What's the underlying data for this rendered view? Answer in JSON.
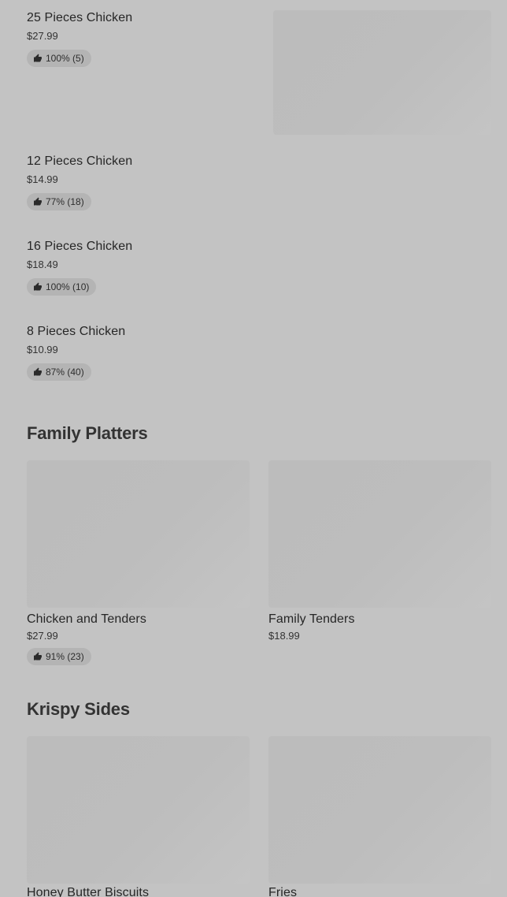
{
  "top_items": [
    {
      "name": "25 Pieces Chicken",
      "price": "$27.99",
      "rating": "100% (5)"
    },
    {
      "name": "12 Pieces Chicken",
      "price": "$14.99",
      "rating": "77% (18)"
    },
    {
      "name": "16 Pieces Chicken",
      "price": "$18.49",
      "rating": "100% (10)"
    },
    {
      "name": "8 Pieces Chicken",
      "price": "$10.99",
      "rating": "87% (40)"
    }
  ],
  "family_platters": {
    "title": "Family Platters",
    "items": [
      {
        "name": "Chicken and Tenders",
        "price": "$27.99",
        "rating": "91% (23)"
      },
      {
        "name": "Family Tenders",
        "price": "$18.99"
      }
    ]
  },
  "krispy_sides": {
    "title": "Krispy Sides",
    "items": [
      {
        "name": "Honey Butter Biscuits"
      },
      {
        "name": "Fries"
      }
    ]
  },
  "icons": {
    "rating": "thumbs-up-icon"
  },
  "colors": {
    "background": "#c3c3c3",
    "badge": "#b4b4b4",
    "placeholder": "#bdbdbd"
  }
}
